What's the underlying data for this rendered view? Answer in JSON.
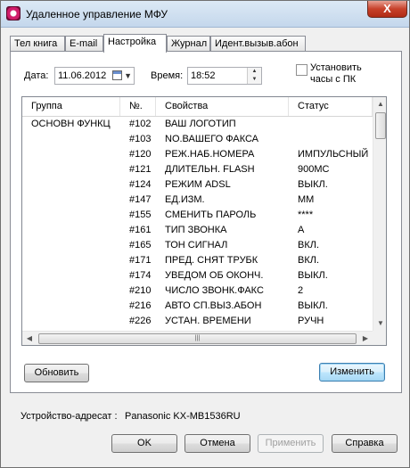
{
  "window": {
    "title": "Удаленное управление МФУ",
    "close_label": "X"
  },
  "tabs": [
    "Тел книга",
    "E-mail",
    "Настройка",
    "Журнал",
    "Идент.вызыв.абон"
  ],
  "settings": {
    "date_label": "Дата:",
    "date_value": "11.06.2012",
    "time_label": "Время:",
    "time_value": "18:52",
    "sync_clock_label_line1": "Установить",
    "sync_clock_label_line2": "часы с ПК"
  },
  "table": {
    "columns": [
      "Группа",
      "№.",
      "Свойства",
      "Статус"
    ],
    "rows": [
      {
        "group": "ОСНОВН ФУНКЦ",
        "num": "#102",
        "prop": "ВАШ ЛОГОТИП",
        "status": ""
      },
      {
        "group": "",
        "num": "#103",
        "prop": "NO.ВАШЕГО ФАКСА",
        "status": ""
      },
      {
        "group": "",
        "num": "#120",
        "prop": "РЕЖ.НАБ.НОМЕРА",
        "status": "ИМПУЛЬСНЫЙ"
      },
      {
        "group": "",
        "num": "#121",
        "prop": "ДЛИТЕЛЬН. FLASH",
        "status": "900МС"
      },
      {
        "group": "",
        "num": "#124",
        "prop": "РЕЖИМ ADSL",
        "status": "ВЫКЛ."
      },
      {
        "group": "",
        "num": "#147",
        "prop": "ЕД.ИЗМ.",
        "status": "ММ"
      },
      {
        "group": "",
        "num": "#155",
        "prop": "СМЕНИТЬ ПАРОЛЬ",
        "status": "****"
      },
      {
        "group": "",
        "num": "#161",
        "prop": "ТИП ЗВОНКА",
        "status": "A"
      },
      {
        "group": "",
        "num": "#165",
        "prop": "ТОН СИГНАЛ",
        "status": "ВКЛ."
      },
      {
        "group": "",
        "num": "#171",
        "prop": "ПРЕД. СНЯТ ТРУБК",
        "status": "ВКЛ."
      },
      {
        "group": "",
        "num": "#174",
        "prop": "УВЕДОМ ОБ ОКОНЧ.",
        "status": "ВЫКЛ."
      },
      {
        "group": "",
        "num": "#210",
        "prop": "ЧИСЛО ЗВОНК.ФАКС",
        "status": "2"
      },
      {
        "group": "",
        "num": "#216",
        "prop": "АВТО СП.ВЫЗ.АБОН",
        "status": "ВЫКЛ."
      },
      {
        "group": "",
        "num": "#226",
        "prop": "УСТАН. ВРЕМЕНИ",
        "status": "РУЧН"
      }
    ]
  },
  "panel_buttons": {
    "refresh": "Обновить",
    "change": "Изменить"
  },
  "device": {
    "label": "Устройство-адресат :",
    "value": "Panasonic KX-MB1536RU"
  },
  "footer_buttons": {
    "ok": "OK",
    "cancel": "Отмена",
    "apply": "Применить",
    "help": "Справка"
  }
}
